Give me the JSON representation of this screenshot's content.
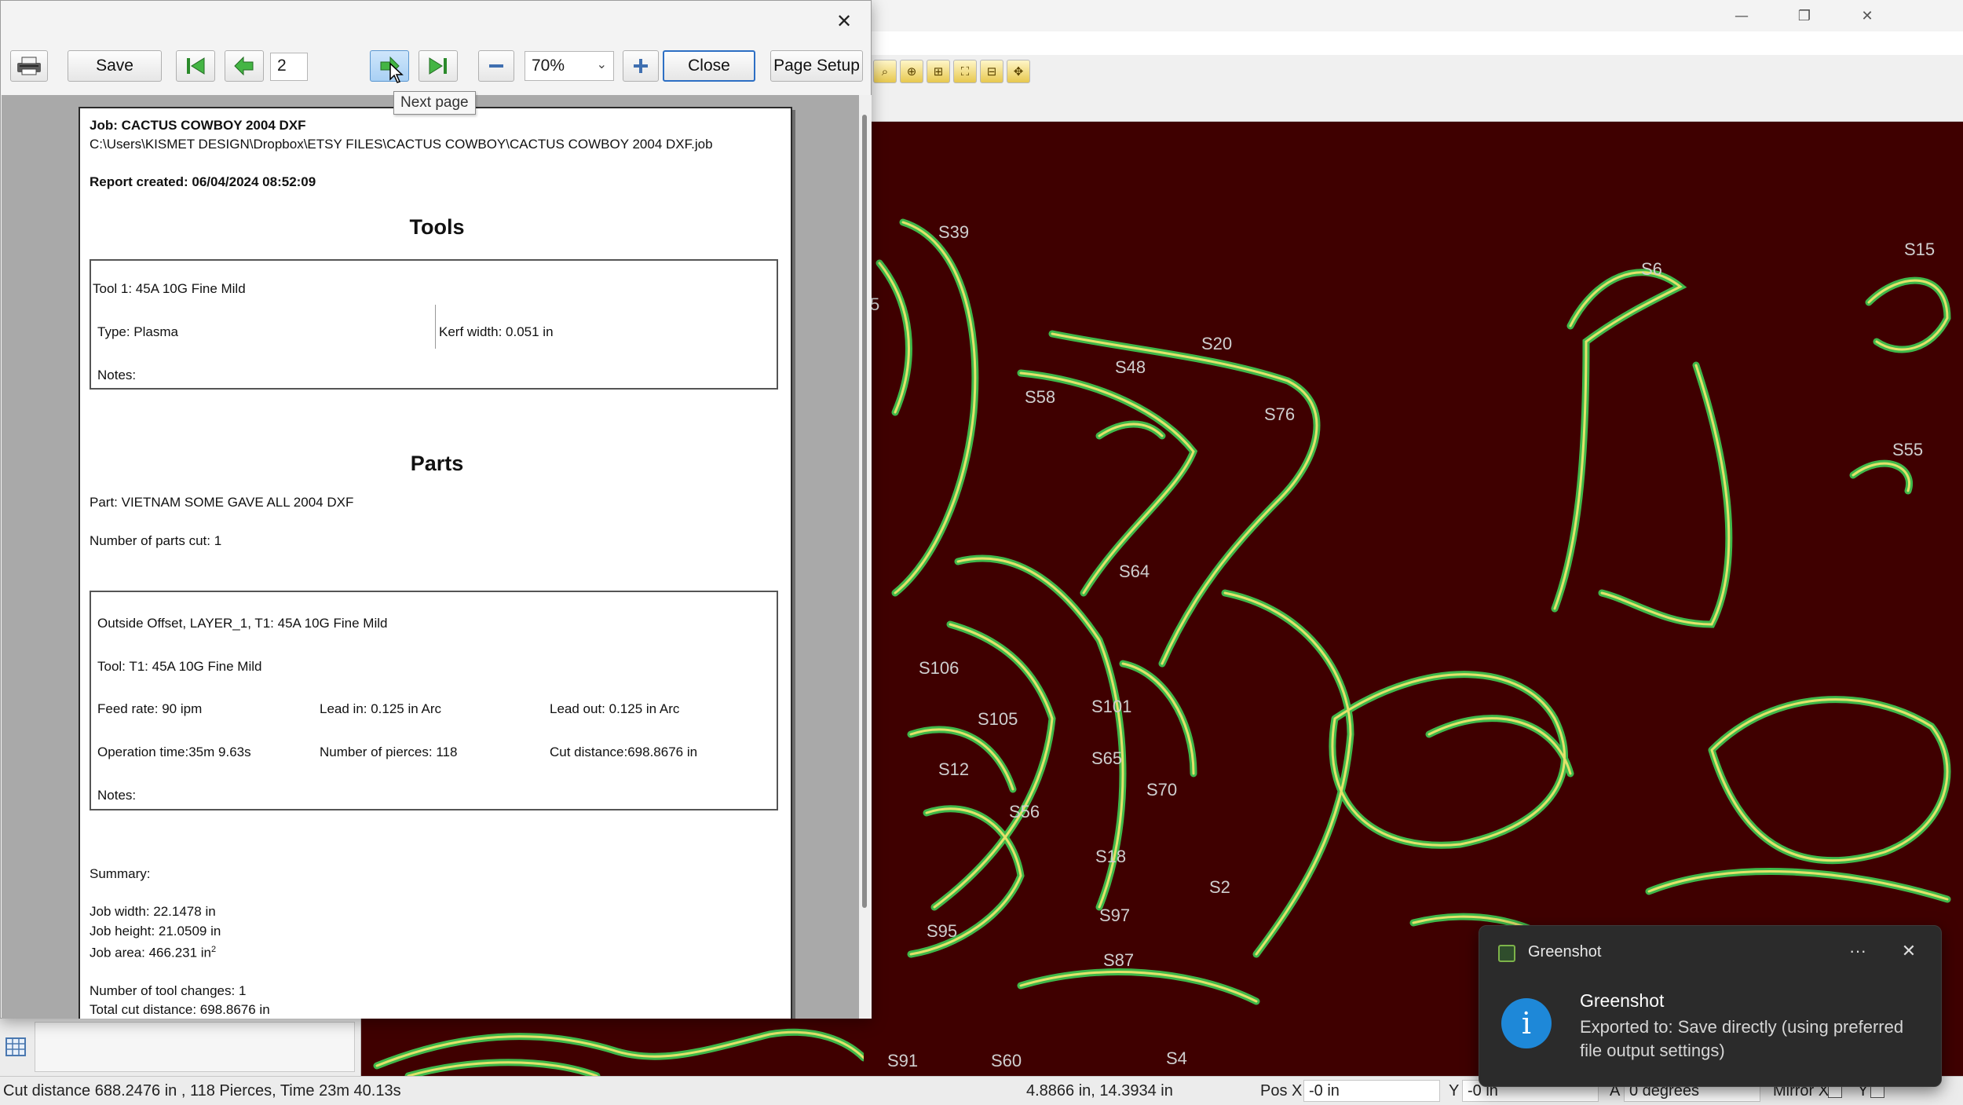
{
  "app": {
    "window_controls": {
      "minimize": "—",
      "restore": "❐",
      "close": "✕"
    },
    "part_labels": [
      "S39",
      "S20",
      "S48",
      "S58",
      "S76",
      "S6",
      "S15",
      "S55",
      "S64",
      "S106",
      "S101",
      "S105",
      "S65",
      "S12",
      "S70",
      "S56",
      "S18",
      "S2",
      "S97",
      "S95",
      "S87",
      "S4",
      "S91",
      "S60",
      "5"
    ],
    "colors": {
      "canvas_bg": "#3f0000",
      "outline_yellow": "#e2e26a",
      "outline_green": "#3fb84a"
    }
  },
  "dialog": {
    "toolbar": {
      "save_label": "Save",
      "page_number": "2",
      "zoom_value": "70%",
      "close_label": "Close",
      "page_setup_label": "Page Setup",
      "tooltip": "Next page"
    },
    "report": {
      "job_line": "Job: CACTUS COWBOY 2004 DXF",
      "path_line": "C:\\Users\\KISMET DESIGN\\Dropbox\\ETSY FILES\\CACTUS COWBOY\\CACTUS COWBOY 2004 DXF.job",
      "created_line": "Report created: 06/04/2024 08:52:09",
      "tools_heading": "Tools",
      "tool_line": "Tool 1: 45A 10G Fine Mild",
      "type_line": "Type: Plasma",
      "kerf_line": "Kerf width: 0.051 in",
      "tool_notes": "Notes:",
      "parts_heading": "Parts",
      "part_line": "Part: VIETNAM SOME GAVE ALL 2004 DXF",
      "parts_cut_line": "Number of parts cut: 1",
      "offset_line": "Outside Offset, LAYER_1, T1: 45A 10G Fine Mild",
      "op_tool_line": "Tool: T1: 45A 10G Fine Mild",
      "feed_rate": "Feed rate: 90 ipm",
      "lead_in": "Lead in: 0.125 in Arc",
      "lead_out": "Lead out: 0.125 in Arc",
      "op_time": "Operation time:35m 9.63s",
      "pierces": "Number of pierces: 118",
      "cut_distance": "Cut distance:698.8676 in",
      "op_notes": "Notes:",
      "summary_label": "Summary:",
      "job_width": "Job width: 22.1478 in",
      "job_height": "Job height: 21.0509 in",
      "job_area": "Job area: 466.231 in",
      "job_area_sup": "2",
      "tool_changes": "Number of tool changes: 1",
      "total_cut": "Total cut distance: 698.8676 in"
    }
  },
  "statusbar": {
    "cut_summary": "Cut distance 688.2476 in , 118 Pierces, Time 23m 40.13s",
    "cursor_coords": "4.8866 in, 14.3934 in",
    "pos_x_label": "Pos X",
    "pos_x_value": "-0 in",
    "y_label": "Y",
    "y_value": "-0 in",
    "angle_prefix": "A",
    "angle_value": "0 degrees",
    "mirror_x_label": "Mirror X",
    "mirror_y_label": "Y"
  },
  "toast": {
    "app_name": "Greenshot",
    "more": "···",
    "close": "✕",
    "info_glyph": "i",
    "title": "Greenshot",
    "body": "Exported to: Save directly (using preferred file output settings)"
  }
}
